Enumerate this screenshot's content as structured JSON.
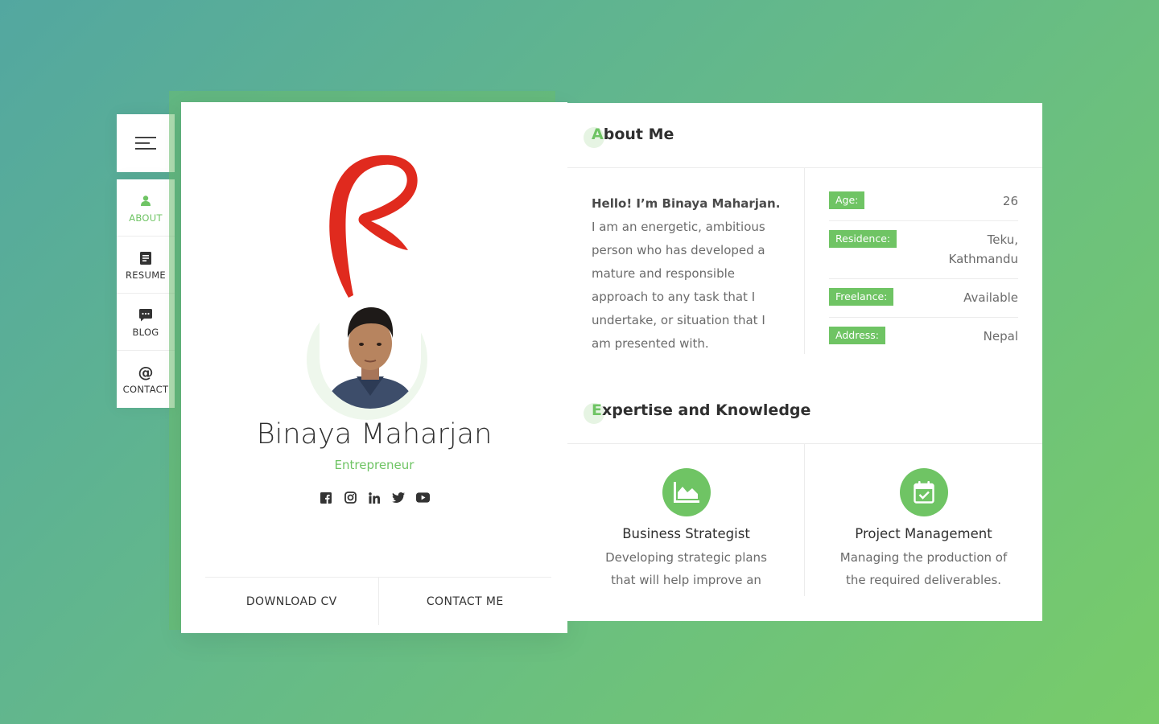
{
  "nav": {
    "items": [
      {
        "label": "ABOUT",
        "icon": "user-icon",
        "active": true
      },
      {
        "label": "RESUME",
        "icon": "document-icon",
        "active": false
      },
      {
        "label": "BLOG",
        "icon": "chat-icon",
        "active": false
      },
      {
        "label": "CONTACT",
        "icon": "at-icon",
        "active": false
      }
    ]
  },
  "profile": {
    "name": "Binaya Maharjan",
    "role": "Entrepreneur",
    "socials": [
      "facebook-icon",
      "instagram-icon",
      "linkedin-icon",
      "twitter-icon",
      "youtube-icon"
    ],
    "download_label": "DOWNLOAD CV",
    "contact_label": "CONTACT ME"
  },
  "about": {
    "title_first": "A",
    "title_rest": "bout Me",
    "hello": "Hello! I’m Binaya Maharjan.",
    "text": "I am an energetic, ambitious person who has developed a mature and responsible approach to any task that I undertake, or situation that I am presented with.",
    "info": [
      {
        "label": "Age:",
        "value": "26"
      },
      {
        "label": "Residence:",
        "value": "Teku, Kathmandu"
      },
      {
        "label": "Freelance:",
        "value": "Available"
      },
      {
        "label": "Address:",
        "value": "Nepal"
      }
    ]
  },
  "expertise": {
    "title_first": "E",
    "title_rest": "xpertise and Knowledge",
    "items": [
      {
        "icon": "chart-area-icon",
        "title": "Business Strategist",
        "desc": "Developing strategic plans that will help improve an"
      },
      {
        "icon": "calendar-check-icon",
        "title": "Project Management",
        "desc": "Managing the production of the required deliverables."
      }
    ]
  },
  "colors": {
    "accent": "#6fc464",
    "gradient_start": "#53a7a0",
    "gradient_end": "#78cc69",
    "logo_red": "#e02a1e"
  }
}
